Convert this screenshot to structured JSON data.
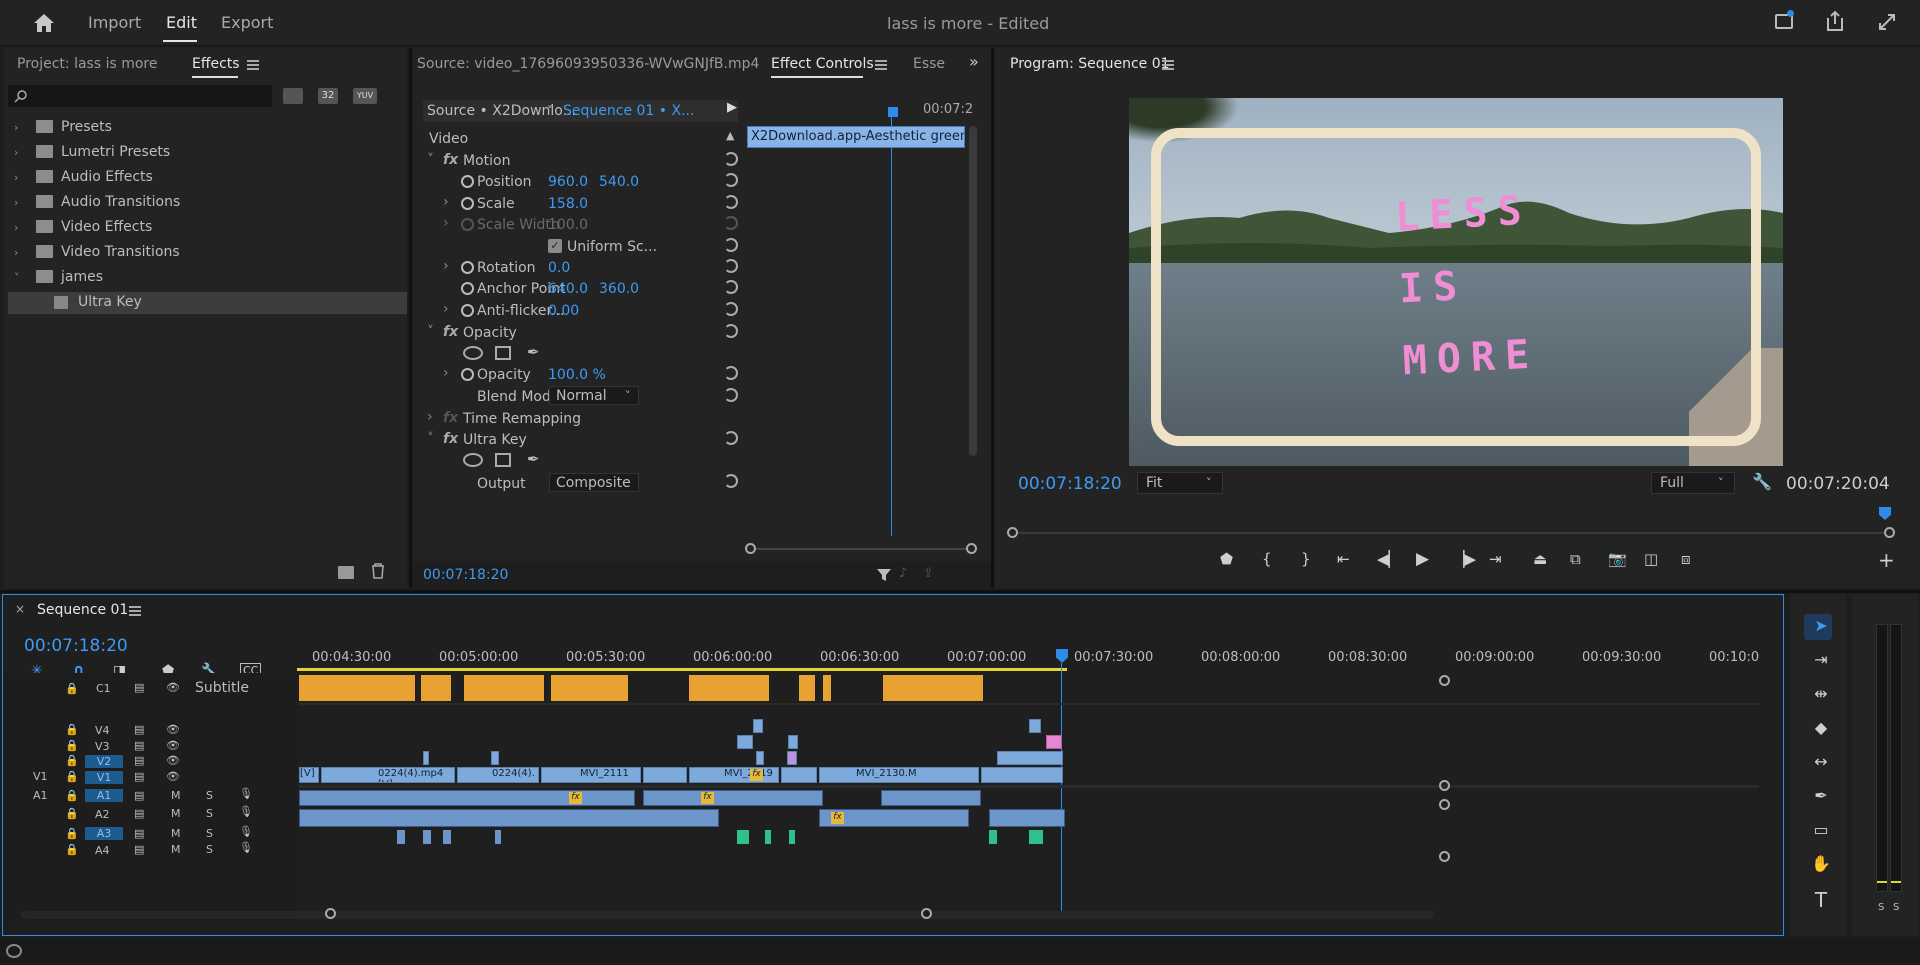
{
  "topbar": {
    "import": "Import",
    "edit": "Edit",
    "export": "Export",
    "title": "lass is more",
    "edited": " - Edited"
  },
  "project_panel": {
    "project_tab": "Project: lass is more",
    "effects_tab": "Effects",
    "badge_32": "32",
    "badge_yuv": "YUV",
    "items": [
      {
        "label": "Presets"
      },
      {
        "label": "Lumetri Presets"
      },
      {
        "label": "Audio Effects"
      },
      {
        "label": "Audio Transitions"
      },
      {
        "label": "Video Effects"
      },
      {
        "label": "Video Transitions"
      },
      {
        "label": "james"
      },
      {
        "label": "Ultra Key"
      }
    ]
  },
  "source_panel": {
    "source_tab": "Source: video_17696093950336-WVwGNJfB.mp4",
    "effect_controls_tab": "Effect Controls",
    "essential_tab": "Esse",
    "source_select": "Source • X2Downlo...",
    "sequence_select": "Sequence 01 • X...",
    "time_label": "00:07:2",
    "clip_name": "X2Download.app-Aesthetic green s",
    "current_time": "00:07:18:20",
    "video_header": "Video",
    "motion": "Motion",
    "position": "Position",
    "position_x": "960.0",
    "position_y": "540.0",
    "scale": "Scale",
    "scale_val": "158.0",
    "scale_width": "Scale Width",
    "scale_width_val": "100.0",
    "uniform_scale": "Uniform Sc...",
    "rotation": "Rotation",
    "rotation_val": "0.0",
    "anchor_point": "Anchor Point",
    "anchor_x": "640.0",
    "anchor_y": "360.0",
    "anti_flicker": "Anti-flicker...",
    "anti_flicker_val": "0.00",
    "opacity_group": "Opacity",
    "opacity": "Opacity",
    "opacity_val": "100.0 %",
    "blend_mode": "Blend Mode",
    "blend_val": "Normal",
    "time_remapping": "Time Remapping",
    "ultra_key": "Ultra Key",
    "output": "Output",
    "output_val": "Composite"
  },
  "program_panel": {
    "title": "Program: Sequence 01",
    "current_time": "00:07:18:20",
    "fit": "Fit",
    "quality": "Full",
    "duration": "00:07:20:04",
    "overlay_line1": "LESS",
    "overlay_line2": "IS",
    "overlay_line3": "MORE"
  },
  "timeline": {
    "tab": "Sequence 01",
    "current_time": "00:07:18:20",
    "ticks": [
      "00:04:30:00",
      "00:05:00:00",
      "00:05:30:00",
      "00:06:00:00",
      "00:06:30:00",
      "00:07:00:00",
      "00:07:30:00",
      "00:08:00:00",
      "00:08:30:00",
      "00:09:00:00",
      "00:09:30:00",
      "00:10:0"
    ],
    "subtitle_track": "C1",
    "subtitle_label": "Subtitle",
    "video_tracks": [
      "V4",
      "V3",
      "V2",
      "V1"
    ],
    "audio_tracks": [
      "A1",
      "A2",
      "A3",
      "A4"
    ],
    "src_v": "V1",
    "src_a": "A1",
    "m": "M",
    "s": "S",
    "clips": [
      "[V]",
      "0224(4).mp4 [V]",
      "0224(4).",
      "MVI_2111",
      "MVI_2119",
      "MVI_2130.M"
    ],
    "fx": "fx"
  },
  "meters": {
    "s1": "S",
    "s2": "S"
  }
}
